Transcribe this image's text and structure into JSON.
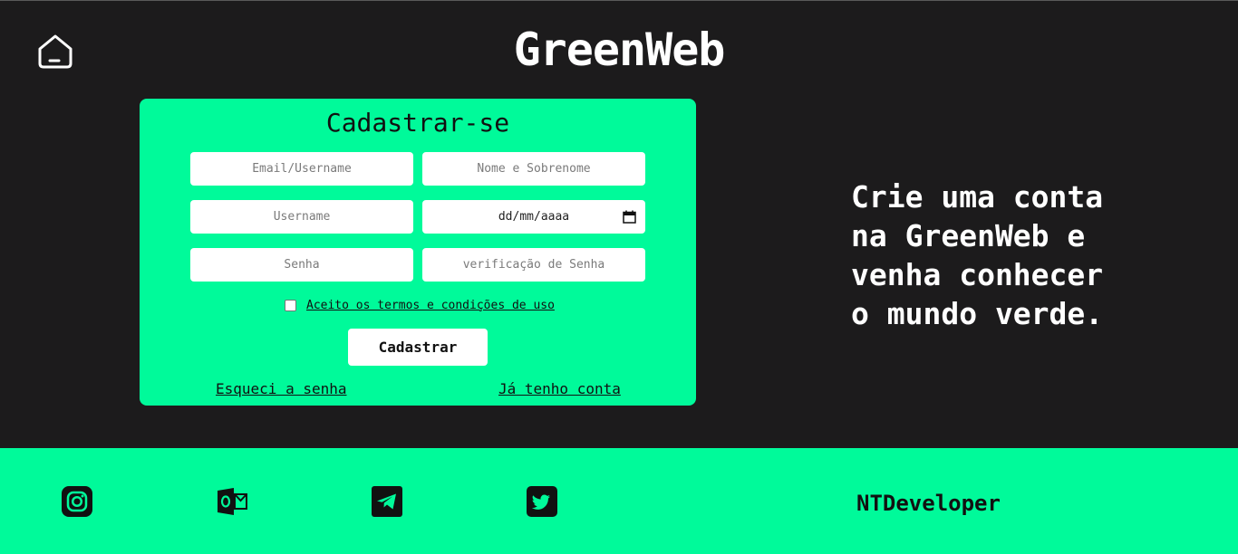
{
  "header": {
    "brand": "GreenWeb",
    "home_icon": "home-icon"
  },
  "signup": {
    "title": "Cadastrar-se",
    "fields": {
      "email_placeholder": "Email/Username",
      "fullname_placeholder": "Nome e Sobrenome",
      "username_placeholder": "Username",
      "birthdate_display": "dd/mm/aaaa",
      "password_placeholder": "Senha",
      "password_confirm_placeholder": "verificação de Senha"
    },
    "terms_label": "Aceito os termos e condições de uso",
    "terms_checked": false,
    "submit_label": "Cadastrar",
    "forgot_label": "Esqueci a senha",
    "have_account_label": "Já tenho conta"
  },
  "tagline": {
    "line1": "Crie uma conta",
    "line2": "na GreenWeb e",
    "line3": "venha conhecer",
    "line4": "o mundo verde."
  },
  "footer": {
    "icons": [
      "instagram-icon",
      "outlook-icon",
      "telegram-icon",
      "twitter-icon"
    ],
    "developer": "NTDeveloper"
  },
  "colors": {
    "background": "#1c1b1c",
    "accent": "#00fa9a",
    "text_light": "#ffffff",
    "text_dark": "#111111"
  }
}
